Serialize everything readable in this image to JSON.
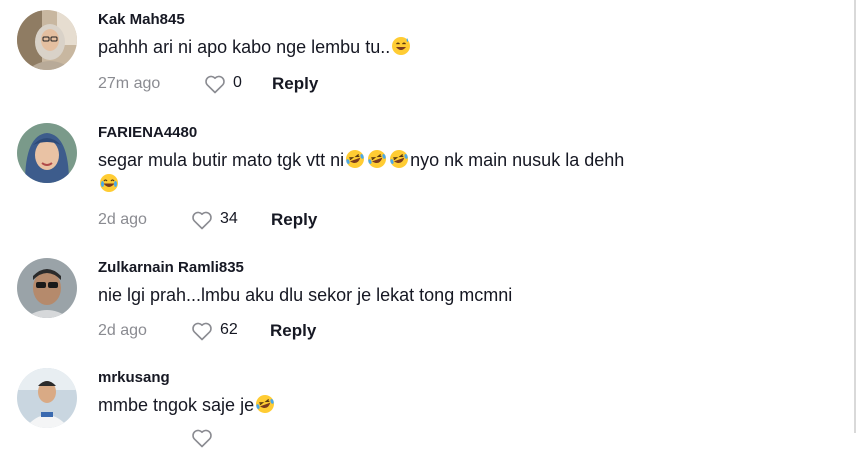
{
  "comments": [
    {
      "username": "Kak Mah845",
      "text": "pahhh ari ni apo kabo nge lembu tu..",
      "emoji": "sweat-smile",
      "time": "27m ago",
      "likes": "0",
      "reply_label": "Reply"
    },
    {
      "username": "FARIENA4480",
      "text_part1": "segar mula butir mato tgk vtt ni",
      "text_part2": "nyo nk main nusuk la dehh",
      "emoji": "rofl",
      "emoji_end": "joy",
      "time": "2d ago",
      "likes": "34",
      "reply_label": "Reply"
    },
    {
      "username": "Zulkarnain Ramli835",
      "text": "nie lgi prah...lmbu aku dlu sekor je lekat tong mcmni",
      "time": "2d ago",
      "likes": "62",
      "reply_label": "Reply"
    },
    {
      "username": "mrkusang",
      "text": "mmbe tngok saje je",
      "emoji": "rofl"
    }
  ],
  "colors": {
    "text": "#161823",
    "muted": "#8a8b91"
  }
}
